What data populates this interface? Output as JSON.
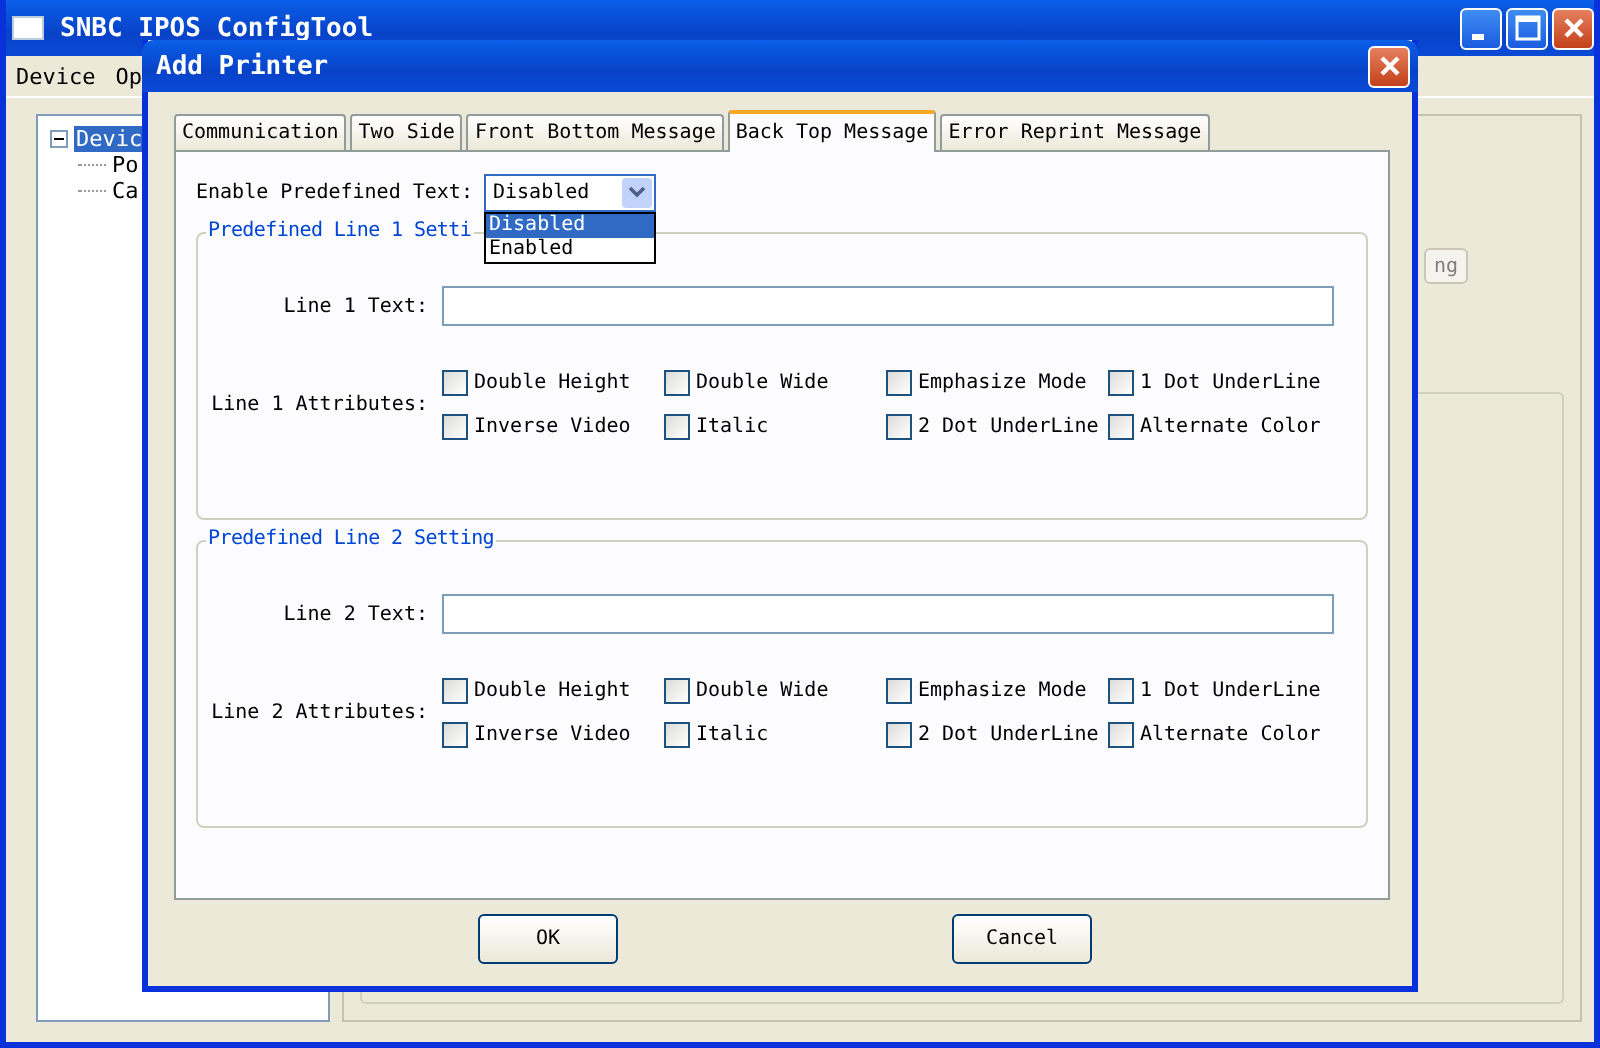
{
  "main_window": {
    "title": "SNBC IPOS ConfigTool",
    "menu": [
      "Device",
      "Op"
    ],
    "tree": {
      "label": "Devic",
      "expanded": true,
      "selected": true,
      "children": [
        {
          "label": "Po"
        },
        {
          "label": "Ca"
        }
      ]
    },
    "background_button": "ng"
  },
  "dialog": {
    "title": "Add Printer",
    "tabs": [
      {
        "label": "Communication",
        "selected": false
      },
      {
        "label": "Two Side",
        "selected": false
      },
      {
        "label": "Front Bottom Message",
        "selected": false
      },
      {
        "label": "Back Top Message",
        "selected": true
      },
      {
        "label": "Error Reprint Message",
        "selected": false
      }
    ],
    "enable_predefined_text": {
      "label": "Enable Predefined Text:",
      "value": "Disabled",
      "expanded": true,
      "options": [
        {
          "label": "Disabled",
          "selected": true
        },
        {
          "label": "Enabled",
          "selected": false
        }
      ]
    },
    "groups": [
      {
        "title": "Predefined Line 1 Setti",
        "text_label": "Line 1 Text:",
        "attributes_label": "Line 1 Attributes:",
        "attributes": [
          {
            "label": "Double Height",
            "checked": false
          },
          {
            "label": "Double Wide",
            "checked": false
          },
          {
            "label": "Emphasize Mode",
            "checked": false
          },
          {
            "label": "1 Dot UnderLine",
            "checked": false
          },
          {
            "label": "Inverse Video",
            "checked": false
          },
          {
            "label": "Italic",
            "checked": false
          },
          {
            "label": "2 Dot UnderLine",
            "checked": false
          },
          {
            "label": "Alternate Color",
            "checked": false
          }
        ]
      },
      {
        "title": "Predefined Line 2 Setting",
        "text_label": "Line 2 Text:",
        "attributes_label": "Line 2 Attributes:",
        "attributes": [
          {
            "label": "Double Height",
            "checked": false
          },
          {
            "label": "Double Wide",
            "checked": false
          },
          {
            "label": "Emphasize Mode",
            "checked": false
          },
          {
            "label": "1 Dot UnderLine",
            "checked": false
          },
          {
            "label": "Inverse Video",
            "checked": false
          },
          {
            "label": "Italic",
            "checked": false
          },
          {
            "label": "2 Dot UnderLine",
            "checked": false
          },
          {
            "label": "Alternate Color",
            "checked": false
          }
        ]
      }
    ],
    "buttons": [
      "OK",
      "Cancel"
    ]
  }
}
